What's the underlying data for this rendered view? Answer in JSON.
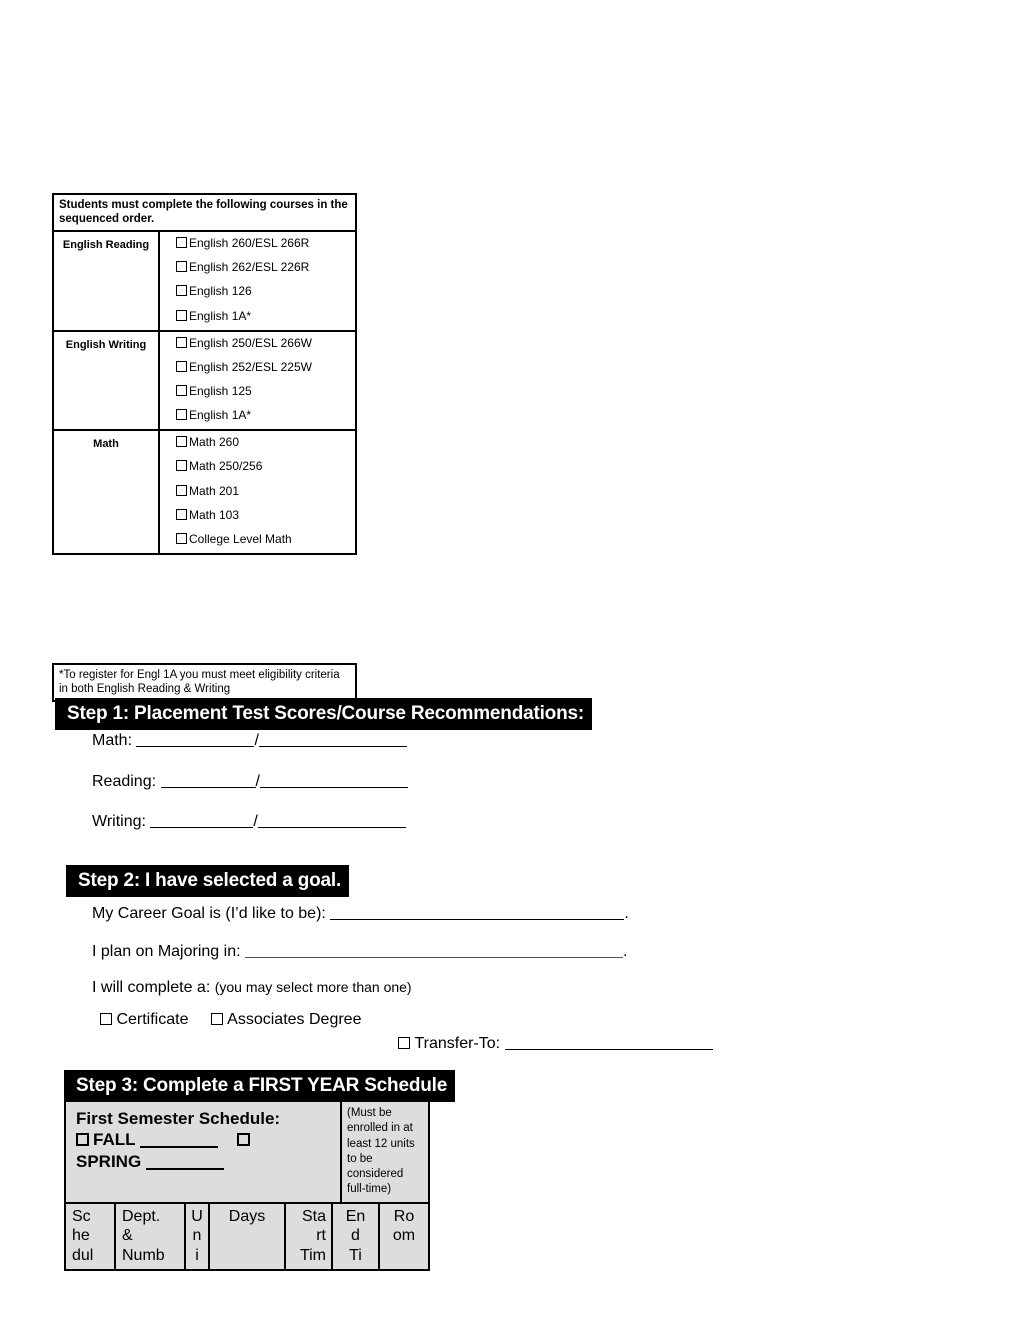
{
  "course_table": {
    "title": "Students must complete the following courses in the sequenced order.",
    "sections": [
      {
        "label": "English Reading",
        "items": [
          "English 260/ESL 266R",
          "English 262/ESL 226R",
          "English 126",
          "English 1A*"
        ]
      },
      {
        "label": "English Writing",
        "items": [
          "English 250/ESL 266W",
          "English 252/ESL 225W",
          "English 125",
          "English 1A*"
        ]
      },
      {
        "label": "Math",
        "items": [
          "Math 260",
          "Math 250/256",
          "Math 201",
          "Math 103",
          "College Level Math"
        ]
      }
    ],
    "footnote": "*To register for Engl 1A you must meet eligibility criteria in both English Reading & Writing"
  },
  "step1": {
    "banner": "Step 1: Placement Test Scores/Course Recommendations:",
    "fields": [
      {
        "label": "Math:",
        "separator": "/"
      },
      {
        "label": "Reading:",
        "separator": "/"
      },
      {
        "label": "Writing:",
        "separator": "/"
      }
    ]
  },
  "step2": {
    "banner": "Step 2: I have selected a goal.",
    "career_label": "My Career Goal is (I’d like to be):",
    "career_period": ".",
    "major_label": "I plan on Majoring in:",
    "major_period": ".",
    "complete_label": "I will complete a:",
    "complete_hint": "(you may select more than one)",
    "options": [
      "Certificate",
      "Associates Degree"
    ],
    "transfer_label": "Transfer-To:"
  },
  "step3": {
    "banner": "Step 3: Complete a FIRST YEAR Schedule",
    "schedule_title": "First Semester Schedule:",
    "term_fall": "FALL",
    "term_spring": "SPRING",
    "note": "(Must be enrolled in at least 12 units to be considered full-time)",
    "columns": [
      {
        "lines": [
          "Sc",
          "he",
          "dul"
        ]
      },
      {
        "lines": [
          "Dept.",
          "&",
          "Numb"
        ]
      },
      {
        "lines": [
          "U",
          "n",
          "i"
        ]
      },
      {
        "lines": [
          "Days",
          "",
          ""
        ]
      },
      {
        "lines": [
          "Sta",
          "rt",
          "Tim"
        ]
      },
      {
        "lines": [
          "En",
          "d",
          "Ti"
        ]
      },
      {
        "lines": [
          "Ro",
          "om",
          ""
        ]
      }
    ]
  },
  "colors": {
    "banner_bg": "#000000",
    "banner_fg": "#ffffff",
    "table_header_bg": "#dddddd",
    "rule": "#000000"
  }
}
